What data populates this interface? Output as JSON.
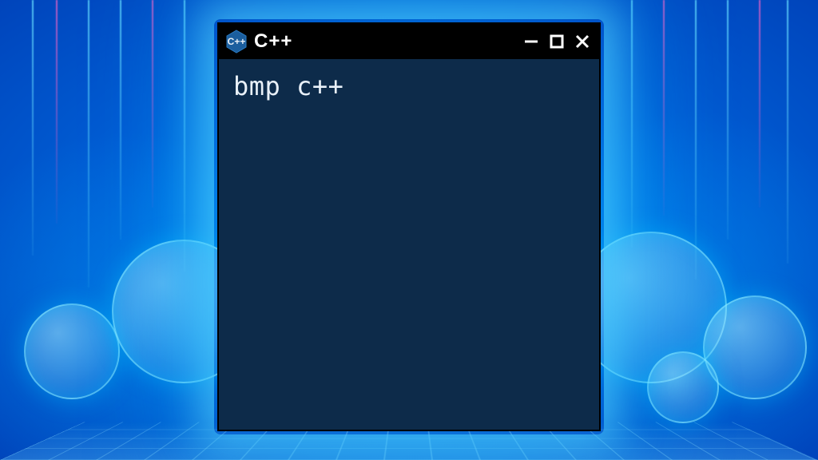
{
  "window": {
    "title": "C++",
    "icon_label": "C++",
    "content_text": "bmp  c++"
  },
  "colors": {
    "window_bg": "#0d2b4a",
    "titlebar_bg": "#000000",
    "text": "#e8f0f8",
    "glow": "#00c8ff"
  }
}
